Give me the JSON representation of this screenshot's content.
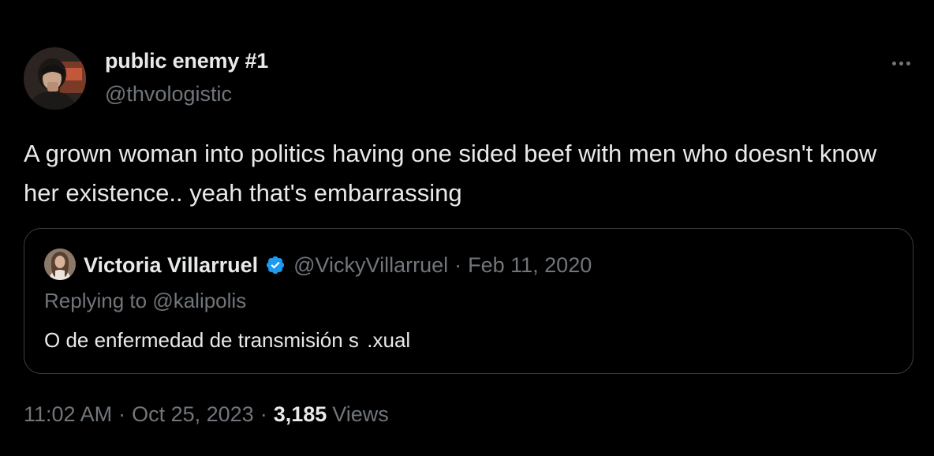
{
  "author": {
    "display_name": "public enemy #1",
    "handle": "@thvologistic"
  },
  "more_icon": "more-horizontal-icon",
  "tweet": {
    "text": "A grown woman into politics having one sided beef with men who doesn't know her existence.. yeah that's embarrassing"
  },
  "quoted_tweet": {
    "display_name": "Victoria Villarruel",
    "verified_icon": "verified-badge-icon",
    "handle": "@VickyVillarruel",
    "separator": "·",
    "date": "Feb 11, 2020",
    "reply_prefix": "Replying to",
    "reply_to": "@kalipolis",
    "text": "O de enfermedad de transmisión s  .xual"
  },
  "meta": {
    "time": "11:02 AM",
    "separator": "·",
    "date": "Oct 25, 2023",
    "views_count": "3,185",
    "views_label": "Views"
  },
  "colors": {
    "background": "#000000",
    "primary_text": "#e7e9ea",
    "secondary_text": "#71767b",
    "border": "#3a3f44",
    "verified_blue": "#1d9bf0"
  }
}
